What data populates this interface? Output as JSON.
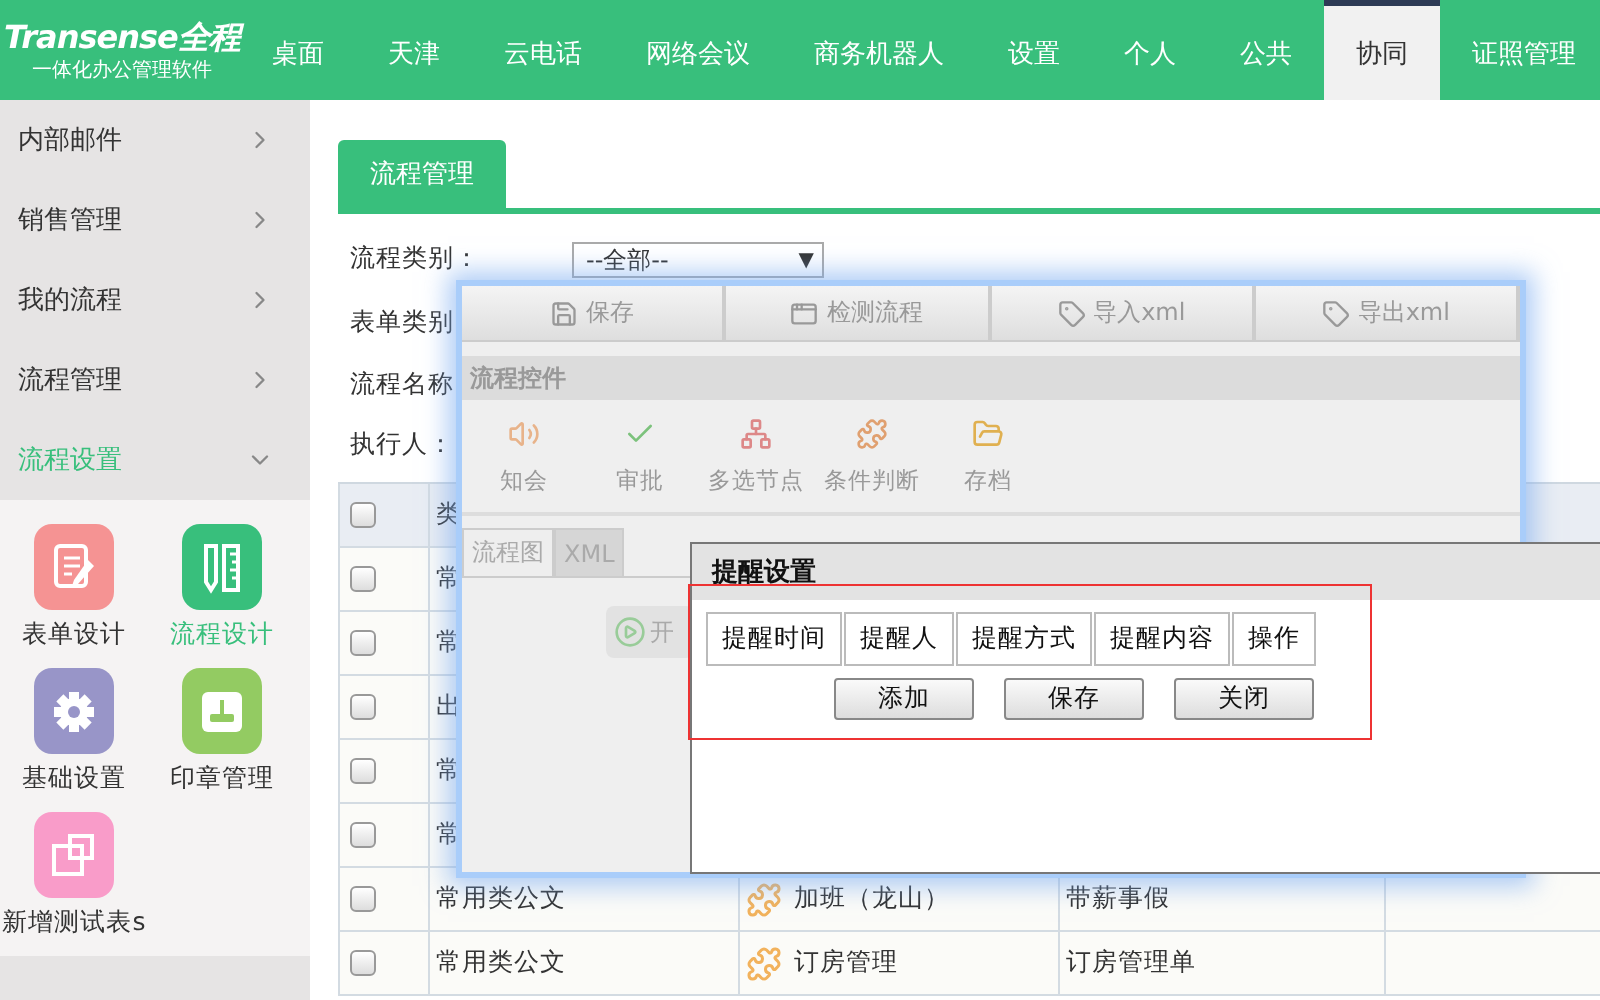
{
  "header": {
    "logo": "Transense全程",
    "slogan": "一体化办公管理软件",
    "nav": [
      {
        "label": "桌面",
        "selected": false
      },
      {
        "label": "天津",
        "selected": false
      },
      {
        "label": "云电话",
        "selected": false
      },
      {
        "label": "网络会议",
        "selected": false
      },
      {
        "label": "商务机器人",
        "selected": false
      },
      {
        "label": "设置",
        "selected": false
      },
      {
        "label": "个人",
        "selected": false
      },
      {
        "label": "公共",
        "selected": false
      },
      {
        "label": "协同",
        "selected": true
      },
      {
        "label": "证照管理",
        "selected": false
      }
    ]
  },
  "sidebar": {
    "items": [
      {
        "label": "内部邮件",
        "expanded": false
      },
      {
        "label": "销售管理",
        "expanded": false
      },
      {
        "label": "我的流程",
        "expanded": false
      },
      {
        "label": "流程管理",
        "expanded": false
      },
      {
        "label": "流程设置",
        "expanded": true
      }
    ],
    "apps": [
      {
        "label": "表单设计",
        "color": "#f59393",
        "selected": false
      },
      {
        "label": "流程设计",
        "color": "#38bf7c",
        "selected": true
      },
      {
        "label": "基础设置",
        "color": "#9895c8",
        "selected": false
      },
      {
        "label": "印章管理",
        "color": "#93cb62",
        "selected": false
      },
      {
        "label": "新增测试表s",
        "color": "#f99cc9",
        "selected": false
      }
    ]
  },
  "main": {
    "tab": "流程管理",
    "filters": [
      {
        "label": "流程类别：",
        "value": "--全部--",
        "arrow": "▼"
      },
      {
        "label": "表单类别"
      },
      {
        "label": "流程名称"
      },
      {
        "label": "执行人："
      }
    ],
    "table": {
      "header": {
        "checked": false,
        "column_2": "类"
      },
      "rows": [
        {
          "checked": false,
          "cells": [
            "常"
          ]
        },
        {
          "checked": false,
          "cells": [
            "常"
          ]
        },
        {
          "checked": false,
          "cells": [
            "出"
          ]
        },
        {
          "checked": false,
          "cells": [
            "常"
          ]
        },
        {
          "checked": false,
          "cells": [
            "常"
          ]
        },
        {
          "checked": false,
          "cells": [
            "常用类公文",
            "加班（龙山）",
            "带薪事假"
          ]
        },
        {
          "checked": false,
          "cells": [
            "常用类公文",
            "订房管理",
            "订房管理单"
          ]
        }
      ]
    }
  },
  "flow_window": {
    "toolbar": [
      "保存",
      "检测流程",
      "导入xml",
      "导出xml"
    ],
    "section_title": "流程控件",
    "controls": [
      "知会",
      "审批",
      "多选节点",
      "条件判断",
      "存档"
    ],
    "tabs": [
      {
        "label": "流程图",
        "selected": true
      },
      {
        "label": "XML",
        "selected": false
      }
    ],
    "start_button": "开"
  },
  "dialog": {
    "title": "提醒设置",
    "columns": [
      "提醒时间",
      "提醒人",
      "提醒方式",
      "提醒内容",
      "操作"
    ],
    "buttons": [
      "添加",
      "保存",
      "关闭"
    ]
  }
}
